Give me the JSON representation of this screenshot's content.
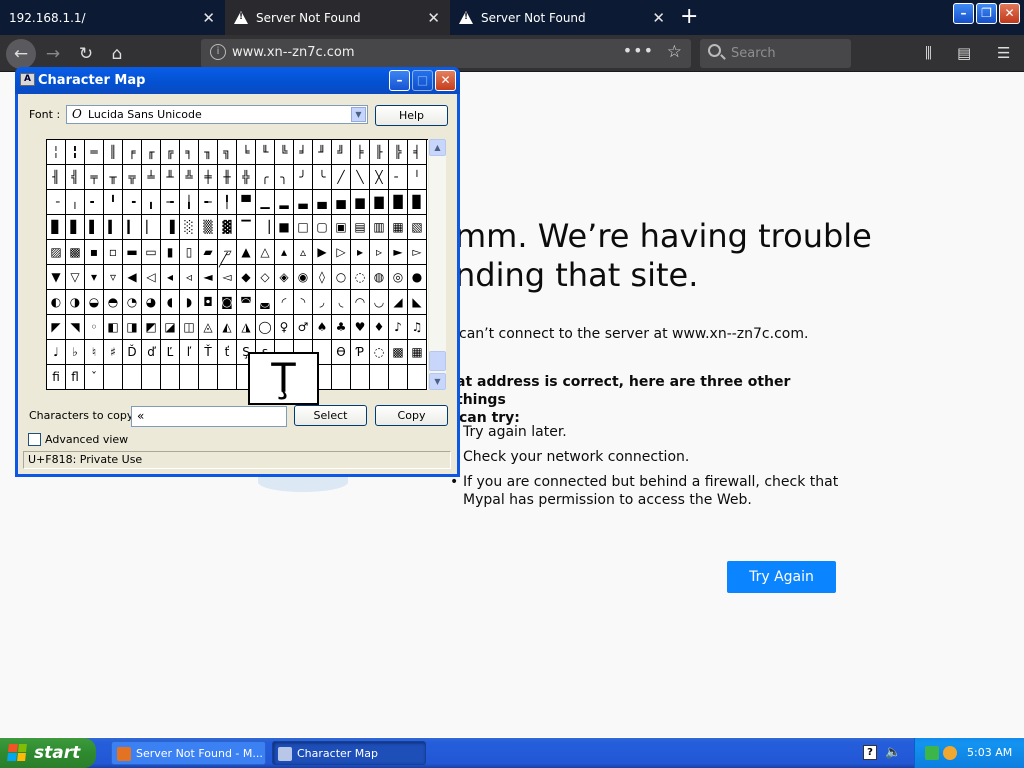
{
  "browser": {
    "tabs": [
      {
        "title": "192.168.1.1/",
        "warning": false
      },
      {
        "title": "Server Not Found",
        "warning": true
      },
      {
        "title": "Server Not Found",
        "warning": true
      }
    ],
    "url": "www.xn--zn7c.com",
    "search_placeholder": "Search",
    "new_tab_symbol": "+",
    "url_actions": "•••"
  },
  "error_page": {
    "title_line1": "mm. We’re having trouble",
    "title_line2": "nding that site.",
    "description": "can’t connect to the server at www.xn--zn7c.com.",
    "suggestion_heading_line1": "at address is correct, here are three other things",
    "suggestion_heading_line2": "can try:",
    "suggestions": [
      "Try again later.",
      "Check your network connection.",
      "If you are connected but behind a firewall, check that Mypal has permission to access the Web."
    ],
    "try_again_label": "Try Again"
  },
  "charmap": {
    "title": "Character Map",
    "font_label": "Font :",
    "font_value": "Lucida Sans Unicode",
    "font_icon": "O",
    "help_label": "Help",
    "grid_rows": [
      [
        "╎",
        "╏",
        "═",
        "║",
        "╒",
        "╓",
        "╔",
        "╕",
        "╖",
        "╗",
        "╘",
        "╙",
        "╚",
        "╛",
        "╜",
        "╝",
        "╞",
        "╟",
        "╠",
        "╡"
      ],
      [
        "╢",
        "╣",
        "╤",
        "╥",
        "╦",
        "╧",
        "╨",
        "╩",
        "╪",
        "╫",
        "╬",
        "╭",
        "╮",
        "╯",
        "╰",
        "╱",
        "╲",
        "╳",
        "╴",
        "╵"
      ],
      [
        "╶",
        "╷",
        "╸",
        "╹",
        "╺",
        "╻",
        "╼",
        "╽",
        "╾",
        "╿",
        "▀",
        "▁",
        "▂",
        "▃",
        "▄",
        "▅",
        "▆",
        "▇",
        "█",
        "▉"
      ],
      [
        "▊",
        "▋",
        "▌",
        "▍",
        "▎",
        "▏",
        "▐",
        "░",
        "▒",
        "▓",
        "▔",
        "▕",
        "■",
        "□",
        "▢",
        "▣",
        "▤",
        "▥",
        "▦",
        "▧"
      ],
      [
        "▨",
        "▩",
        "▪",
        "▫",
        "▬",
        "▭",
        "▮",
        "▯",
        "▰",
        "▱",
        "▲",
        "△",
        "▴",
        "▵",
        "▶",
        "▷",
        "▸",
        "▹",
        "►",
        "▻"
      ],
      [
        "▼",
        "▽",
        "▾",
        "▿",
        "◀",
        "◁",
        "◂",
        "◃",
        "◄",
        "◅",
        "◆",
        "◇",
        "◈",
        "◉",
        "◊",
        "○",
        "◌",
        "◍",
        "◎",
        "●"
      ],
      [
        "◐",
        "◑",
        "◒",
        "◓",
        "◔",
        "◕",
        "◖",
        "◗",
        "◘",
        "◙",
        "◚",
        "◛",
        "◜",
        "◝",
        "◞",
        "◟",
        "◠",
        "◡",
        "◢",
        "◣"
      ],
      [
        "◤",
        "◥",
        "◦",
        "◧",
        "◨",
        "◩",
        "◪",
        "◫",
        "◬",
        "◭",
        "◮",
        "◯",
        "♀",
        "♂",
        "♠",
        "♣",
        "♥",
        "♦",
        "♪",
        "♫"
      ],
      [
        "♩",
        "♭",
        "♮",
        "♯",
        "Ď",
        "ď",
        "Ľ",
        "ľ",
        "Ť",
        "ť",
        "Ş",
        "ş",
        "",
        "",
        "",
        "Ɵ",
        "Ƥ",
        "◌",
        "▩",
        "▦"
      ],
      [
        "ﬁ",
        "ﬂ",
        "ˇ",
        "",
        "",
        "",
        "",
        "",
        "",
        "",
        "",
        "",
        "",
        "",
        "",
        "",
        "",
        "",
        "",
        ""
      ]
    ],
    "zoom_char": "Ţ",
    "chars_to_copy_label": "Characters to copy :",
    "chars_to_copy_value": "«",
    "select_label": "Select",
    "copy_label": "Copy",
    "advanced_view_label": "Advanced view",
    "advanced_view_checked": false,
    "status_text": "U+F818: Private Use"
  },
  "taskbar": {
    "start_label": "start",
    "tasks": [
      {
        "label": "Server Not Found - M...",
        "active": false
      },
      {
        "label": "Character Map",
        "active": true
      }
    ],
    "clock": "5:03 AM"
  },
  "colors": {
    "accent_blue": "#0a84ff",
    "xp_title_blue": "#0351d1",
    "xp_taskbar": "#245edb",
    "browser_dark": "#323234"
  }
}
